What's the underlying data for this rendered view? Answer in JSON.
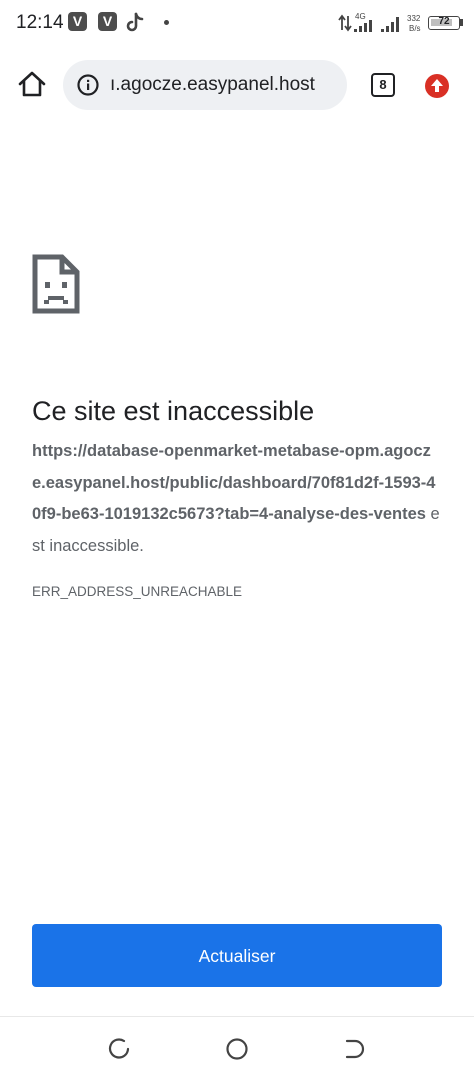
{
  "status_bar": {
    "time": "12:14",
    "app_icons": [
      "V",
      "V"
    ],
    "network_type": "4G",
    "data_rate_value": "332",
    "data_rate_unit": "B/s",
    "battery_level": "72"
  },
  "toolbar": {
    "url_display": "ı.agocze.easypanel.host",
    "tab_count": "8"
  },
  "error_page": {
    "title": "Ce site est inaccessible",
    "url": "https://database-openmarket-metabase-opm.agocze.easypanel.host/public/dashboard/70f81d2f-1593-40f9-be63-1019132c5673?tab=4-analyse-des-ventes",
    "message_suffix": " est inaccessible.",
    "error_code": "ERR_ADDRESS_UNREACHABLE",
    "reload_label": "Actualiser"
  },
  "colors": {
    "accent": "#1a73e8",
    "update_badge": "#d93025",
    "omnibox_bg": "#eef0f3"
  },
  "icons": {
    "home": "home-icon",
    "info": "info-icon",
    "tabs": "tab-switcher-icon",
    "update": "update-icon",
    "error": "sad-document-icon",
    "nav_recents": "recents-icon",
    "nav_home": "nav-home-icon",
    "nav_back": "back-icon"
  }
}
